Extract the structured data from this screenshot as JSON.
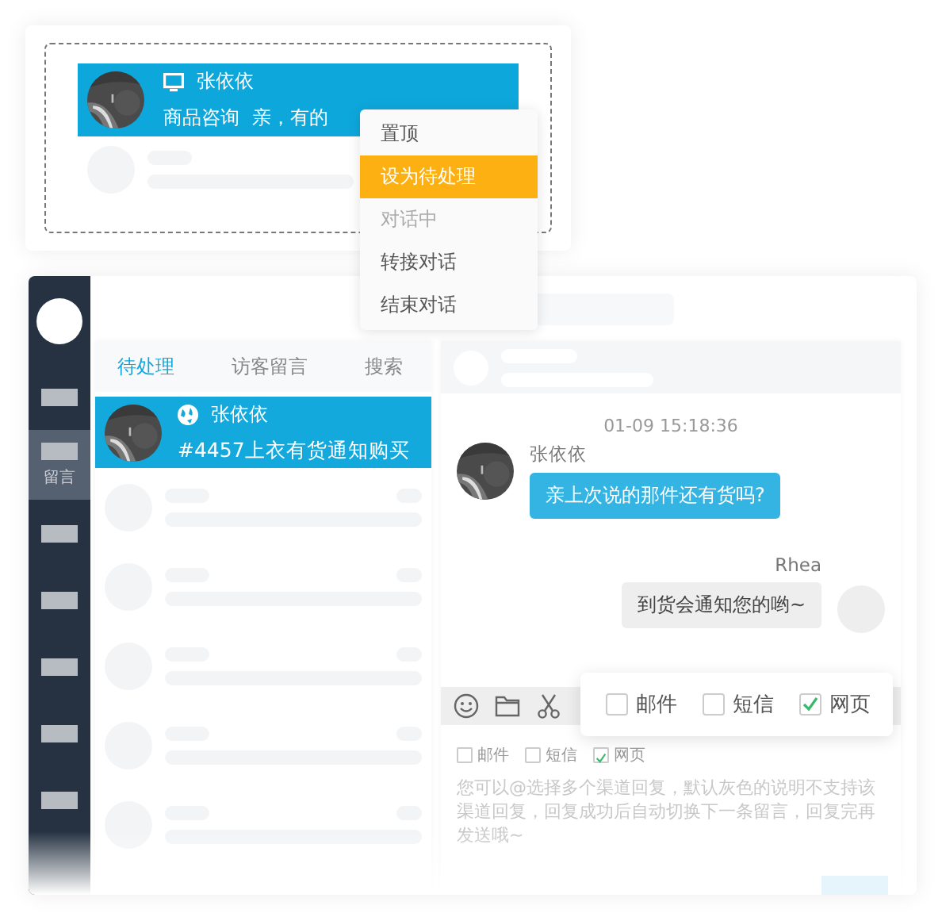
{
  "preview_card": {
    "conversation": {
      "name": "张依依",
      "category": "商品咨询",
      "snippet": "亲，有的",
      "selected": true
    }
  },
  "context_menu": {
    "items": [
      {
        "label": "置顶",
        "highlighted": false,
        "disabled": false
      },
      {
        "label": "设为待处理",
        "highlighted": true,
        "disabled": false
      },
      {
        "label": "对话中",
        "highlighted": false,
        "disabled": true
      },
      {
        "label": "转接对话",
        "highlighted": false,
        "disabled": false
      },
      {
        "label": "结束对话",
        "highlighted": false,
        "disabled": false
      }
    ]
  },
  "main_window": {
    "sidebar": {
      "items": [
        {
          "selected": false
        },
        {
          "label": "留言",
          "selected": true
        },
        {
          "selected": false
        },
        {
          "selected": false
        },
        {
          "selected": false
        },
        {
          "selected": false
        },
        {
          "selected": false
        }
      ]
    },
    "tabs": [
      {
        "label": "待处理",
        "selected": true
      },
      {
        "label": "访客留言",
        "selected": false
      },
      {
        "label": "搜索",
        "selected": false
      }
    ],
    "conversations": [
      {
        "name": "张依依",
        "message": "#4457上衣有货通知购买",
        "selected": true
      }
    ],
    "chat": {
      "timestamp": "01-09 15:18:36",
      "messages": [
        {
          "kind": "incoming",
          "sender": "张依依",
          "text": "亲上次说的那件还有货吗?"
        },
        {
          "kind": "outgoing",
          "sender": "Rhea",
          "text": "到货会通知您的哟~"
        }
      ]
    },
    "channels": [
      {
        "label": "邮件",
        "checked": false
      },
      {
        "label": "短信",
        "checked": false
      },
      {
        "label": "网页",
        "checked": true
      }
    ],
    "reply_field": {
      "placeholder": "您可以@选择多个渠道回复，默认灰色的说明不支持该渠道回复，回复成功后自动切换下一条留言，回复完再发送哦~"
    },
    "channel_popup": [
      {
        "label": "邮件",
        "checked": false
      },
      {
        "label": "短信",
        "checked": false
      },
      {
        "label": "网页",
        "checked": true
      }
    ]
  }
}
